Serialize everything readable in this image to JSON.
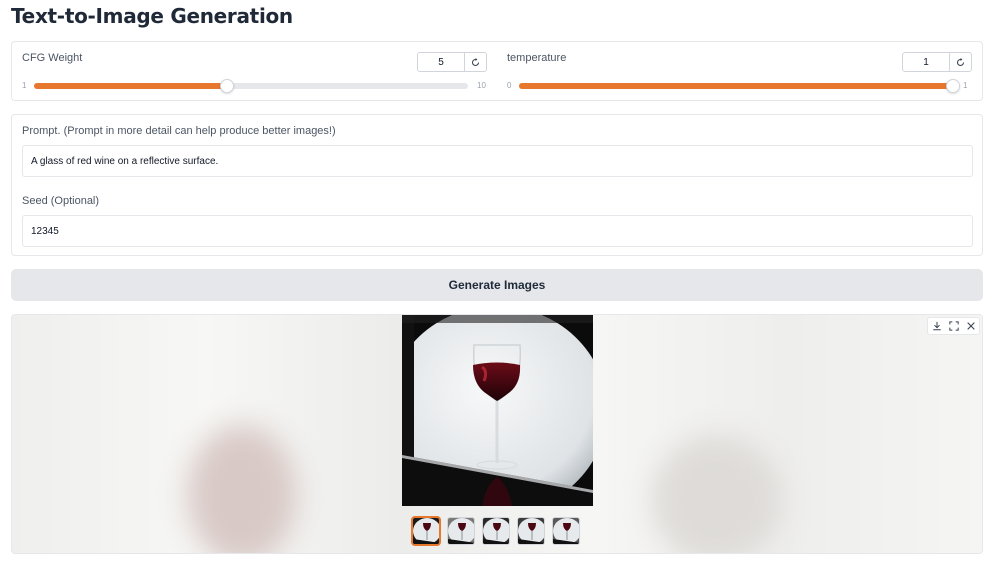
{
  "page": {
    "title": "Text-to-Image Generation"
  },
  "sliders": {
    "cfg": {
      "label": "CFG Weight",
      "value": "5",
      "min": "1",
      "max": "10",
      "fraction": 0.444
    },
    "temperature": {
      "label": "temperature",
      "value": "1",
      "min": "0",
      "max": "1",
      "fraction": 1.0
    },
    "accent_color": "#e8772e"
  },
  "prompt": {
    "label": "Prompt. (Prompt in more detail can help produce better images!)",
    "value": "A glass of red wine on a reflective surface."
  },
  "seed": {
    "label": "Seed (Optional)",
    "value": "12345"
  },
  "generate_button": {
    "label": "Generate Images"
  },
  "gallery": {
    "selected_index": 0,
    "thumbnail_count": 5,
    "toolbar_icons": [
      "download-icon",
      "fullscreen-icon",
      "close-icon"
    ]
  }
}
